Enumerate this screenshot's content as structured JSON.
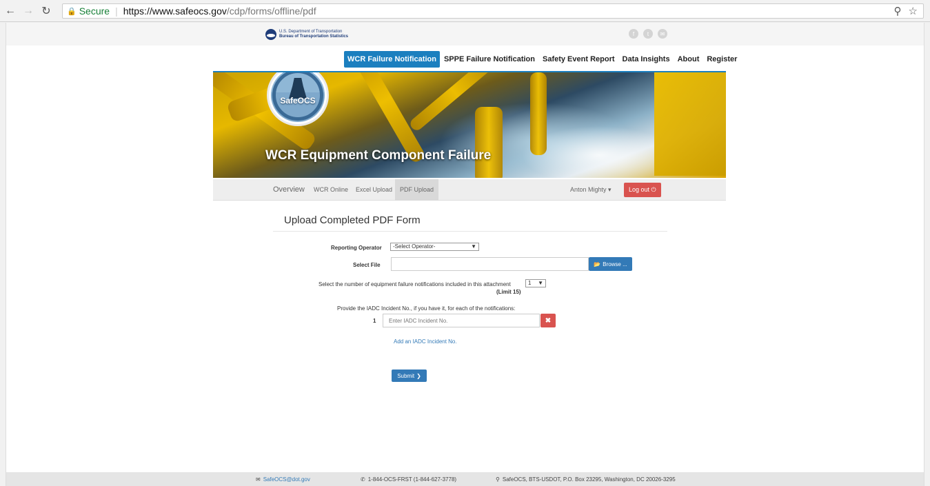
{
  "browser": {
    "secure_label": "Secure",
    "url_host": "https://www.safeocs.gov",
    "url_path": "/cdp/forms/offline/pdf"
  },
  "header": {
    "dot_line1": "U.S. Department of Transportation",
    "dot_line2": "Bureau of Transportation Statistics"
  },
  "nav": {
    "items": [
      {
        "label": "WCR Failure Notification"
      },
      {
        "label": "SPPE Failure Notification"
      },
      {
        "label": "Safety Event Report"
      },
      {
        "label": "Data Insights"
      },
      {
        "label": "About"
      },
      {
        "label": "Register"
      }
    ]
  },
  "hero": {
    "title": "WCR Equipment Component Failure",
    "badge_text": "SafeOCS"
  },
  "subnav": {
    "overview": "Overview",
    "wcr_online": "WCR Online",
    "excel_upload": "Excel Upload",
    "pdf_upload": "PDF Upload",
    "user": "Anton Mighty",
    "logout": "Log out"
  },
  "form": {
    "title": "Upload Completed PDF Form",
    "operator_label": "Reporting Operator",
    "operator_value": "-Select Operator-",
    "file_label": "Select File",
    "browse_label": "Browse ...",
    "count_label": "Select the number of equipment failure notifications included in this attachment",
    "count_value": "1",
    "count_limit": "(Limit 15)",
    "iadc_prompt": "Provide the IADC Incident No., if you have it, for each of the notifications:",
    "row_number": "1",
    "iadc_placeholder": "Enter IADC Incident No.",
    "add_link": "Add an IADC Incident No.",
    "submit": "Submit"
  },
  "footer": {
    "email": "SafeOCS@dot.gov",
    "phone": "1-844-OCS-FRST (1-844-627-3778)",
    "address": "SafeOCS, BTS-USDOT, P.O. Box 23295, Washington, DC 20026-3295"
  },
  "colors": {
    "accent": "#1b7fbf",
    "button_blue": "#337ab7",
    "button_red": "#d9534f"
  }
}
